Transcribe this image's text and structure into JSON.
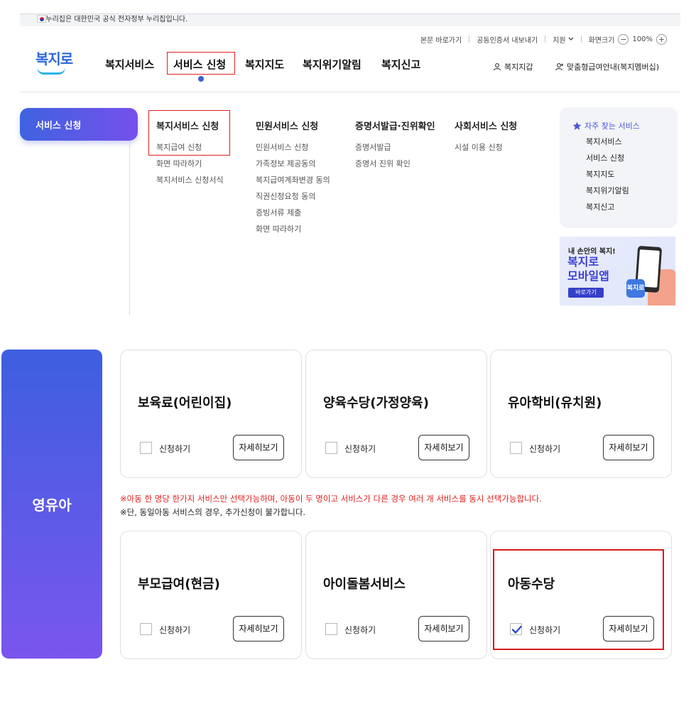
{
  "gov_banner": {
    "text": "이 누리집은 대한민국 공식 전자정부 누리집입니다."
  },
  "utility": {
    "skip_to_content": "본문 바로가기",
    "export_cert": "공동인증서 내보내기",
    "region": "지원",
    "font_size_label": "화면크기",
    "zoom_out": "−",
    "zoom_level": "100%",
    "zoom_in": "+"
  },
  "logo": {
    "text": "복지로"
  },
  "gnb": {
    "items": [
      "복지서비스",
      "서비스 신청",
      "복지지도",
      "복지위기알림",
      "복지신고"
    ],
    "active_index": 1
  },
  "header_right": {
    "wallet": "복지지갑",
    "membership": "맞춤형급여안내(복지멤버십)"
  },
  "mega_menu": {
    "section_label": "서비스 신청",
    "columns": [
      {
        "title": "복지서비스 신청",
        "items": [
          "복지급여 신청",
          "화면 따라하기",
          "복지서비스 신청서식"
        ]
      },
      {
        "title": "민원서비스 신청",
        "items": [
          "민원서비스 신청",
          "가족정보 제공동의",
          "복지급여계좌변경 동의",
          "직권신청요청 동의",
          "증빙서류 제출",
          "화면 따라하기"
        ]
      },
      {
        "title": "증명서발급·진위확인",
        "items": [
          "증명서발급",
          "증명서 진위 확인"
        ]
      },
      {
        "title": "사회서비스 신청",
        "items": [
          "시설 이용 신청"
        ]
      }
    ],
    "favorites": {
      "title": "자주 찾는 서비스",
      "items": [
        "복지서비스",
        "서비스 신청",
        "복지지도",
        "복지위기알림",
        "복지신고"
      ]
    },
    "promo": {
      "line1": "내 손안의 복지!",
      "line2": "복지로",
      "line3": "모바일앱",
      "button": "바로가기",
      "icon_text": "복지로"
    }
  },
  "category": {
    "label": "영유아"
  },
  "services": [
    {
      "title": "보육료(어린이집)",
      "apply_label": "신청하기",
      "checked": false,
      "detail_label": "자세히보기"
    },
    {
      "title": "양육수당(가정양육)",
      "apply_label": "신청하기",
      "checked": false,
      "detail_label": "자세히보기"
    },
    {
      "title": "유아학비(유치원)",
      "apply_label": "신청하기",
      "checked": false,
      "detail_label": "자세히보기"
    },
    {
      "title": "부모급여(현금)",
      "apply_label": "신청하기",
      "checked": false,
      "detail_label": "자세히보기"
    },
    {
      "title": "아이돌봄서비스",
      "apply_label": "신청하기",
      "checked": false,
      "detail_label": "자세히보기"
    },
    {
      "title": "아동수당",
      "apply_label": "신청하기",
      "checked": true,
      "detail_label": "자세히보기"
    }
  ],
  "notices": {
    "warning": "※아동 한 명당 한가지 서비스만 선택가능하며, 아동이 두 명이고 서비스가 다른 경우 여러 개 서비스를 동시 선택가능합니다.",
    "info": "※단, 동일아동 서비스의 경우, 추가신청이 불가합니다."
  },
  "colors": {
    "accent": "#3e63e0",
    "accent_end": "#7650ec",
    "highlight_border": "#e02020",
    "warning_text": "#e01e1e"
  },
  "icons": {
    "wallet": "person-icon",
    "membership": "person-plus-icon",
    "favorites": "star-icon",
    "checkbox_checked": "checkmark-icon"
  }
}
